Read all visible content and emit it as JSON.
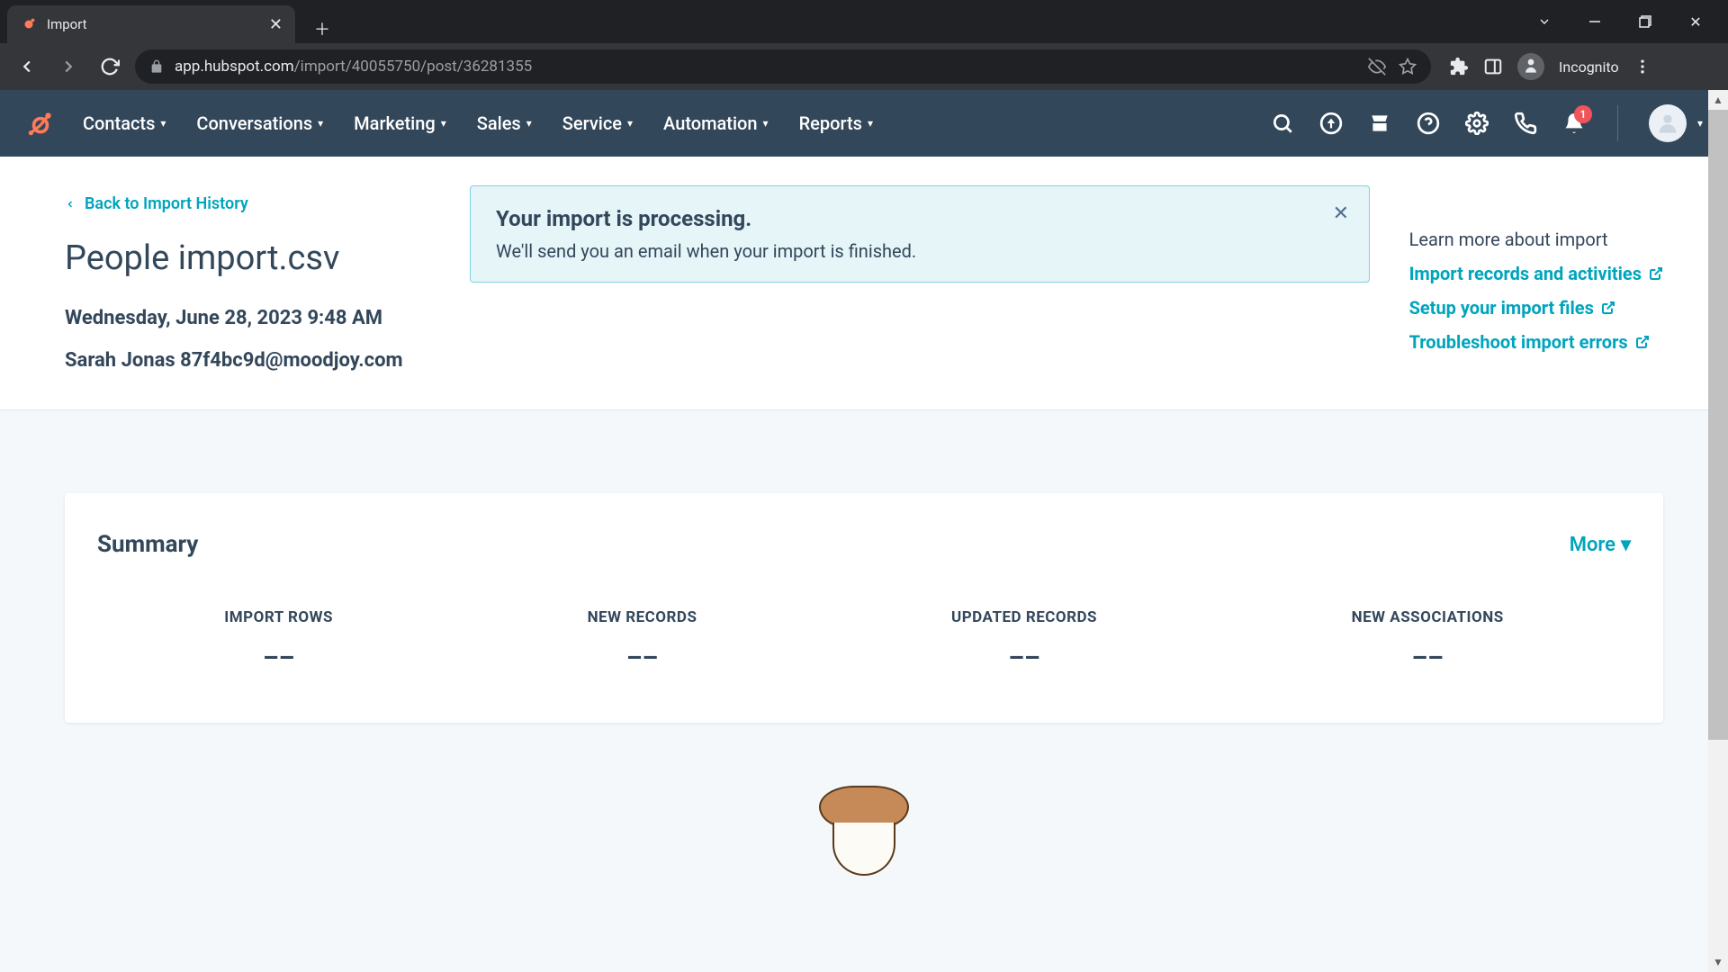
{
  "browser": {
    "tab_title": "Import",
    "url_host": "app.hubspot.com",
    "url_path": "/import/40055750/post/36281355",
    "incognito_label": "Incognito"
  },
  "nav": {
    "items": [
      "Contacts",
      "Conversations",
      "Marketing",
      "Sales",
      "Service",
      "Automation",
      "Reports"
    ],
    "notification_count": "1"
  },
  "page": {
    "back_link": "Back to Import History",
    "title": "People import.csv",
    "date": "Wednesday, June 28, 2023 9:48 AM",
    "user": "Sarah Jonas 87f4bc9d@moodjoy.com"
  },
  "alert": {
    "title": "Your import is processing.",
    "subtitle": "We'll send you an email when your import is finished."
  },
  "help": {
    "heading": "Learn more about import",
    "links": [
      "Import records and activities",
      "Setup your import files",
      "Troubleshoot import errors"
    ]
  },
  "summary": {
    "title": "Summary",
    "more_label": "More",
    "stats": [
      {
        "label": "IMPORT ROWS",
        "value": "––"
      },
      {
        "label": "NEW RECORDS",
        "value": "––"
      },
      {
        "label": "UPDATED RECORDS",
        "value": "––"
      },
      {
        "label": "NEW ASSOCIATIONS",
        "value": "––"
      }
    ]
  }
}
